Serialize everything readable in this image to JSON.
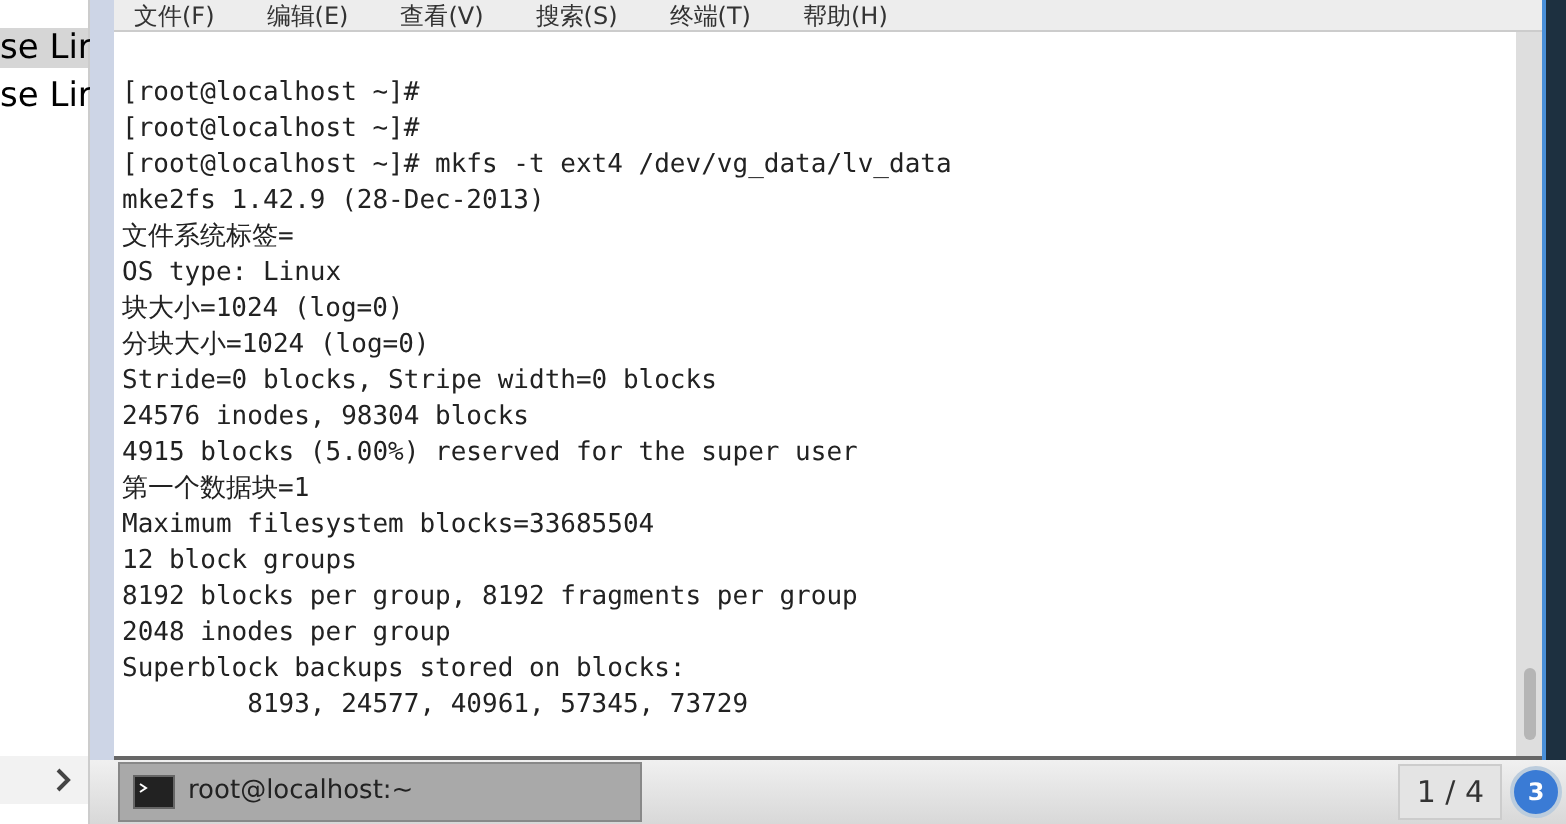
{
  "side_list": {
    "items": [
      {
        "label": "se Lir",
        "selected": true
      },
      {
        "label": "se Lir",
        "selected": false
      }
    ]
  },
  "menu_bar": [
    "文件(F)",
    "编辑(E)",
    "查看(V)",
    "搜索(S)",
    "终端(T)",
    "帮助(H)"
  ],
  "terminal": {
    "lines": [
      "[root@localhost ~]#",
      "[root@localhost ~]#",
      "[root@localhost ~]# mkfs -t ext4 /dev/vg_data/lv_data",
      "mke2fs 1.42.9 (28-Dec-2013)",
      "文件系统标签=",
      "OS type: Linux",
      "块大小=1024 (log=0)",
      "分块大小=1024 (log=0)",
      "Stride=0 blocks, Stripe width=0 blocks",
      "24576 inodes, 98304 blocks",
      "4915 blocks (5.00%) reserved for the super user",
      "第一个数据块=1",
      "Maximum filesystem blocks=33685504",
      "12 block groups",
      "8192 blocks per group, 8192 fragments per group",
      "2048 inodes per group",
      "Superblock backups stored on blocks:",
      "        8193, 24577, 40961, 57345, 73729"
    ]
  },
  "taskbar": {
    "task": "root@localhost:~",
    "pager": "1 / 4",
    "badge": "3"
  }
}
